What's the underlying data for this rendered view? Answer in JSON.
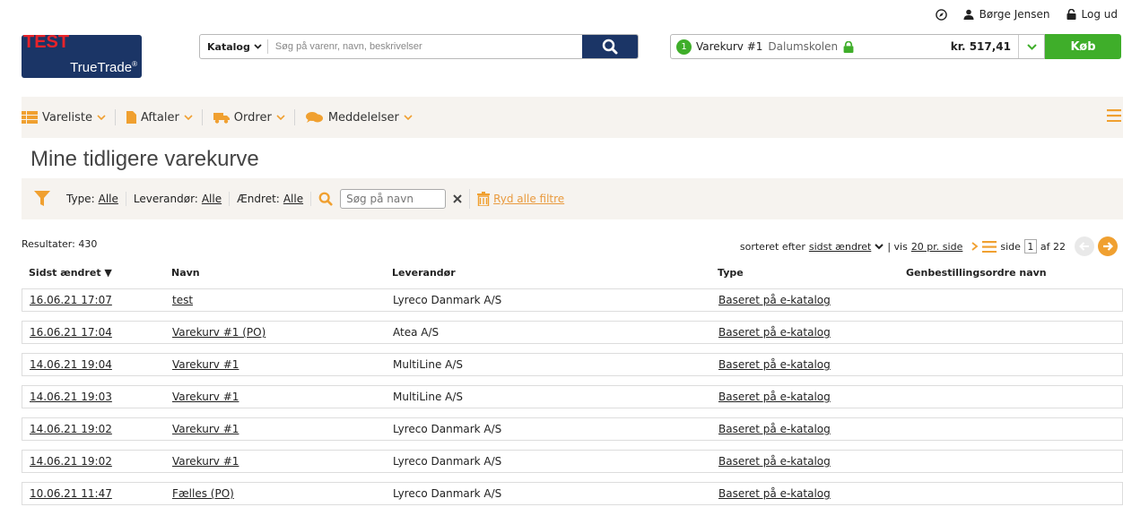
{
  "userbar": {
    "user_name": "Børge Jensen",
    "logout_label": "Log ud"
  },
  "logo": {
    "test_label": "TEST",
    "brand": "TrueTrade",
    "reg": "®"
  },
  "search": {
    "category_label": "Katalog",
    "placeholder": "Søg på varenr, navn, beskrivelser"
  },
  "cart": {
    "count": "1",
    "name": "Varekurv #1",
    "org": "Dalumskolen",
    "price": "kr. 517,41",
    "buy_label": "Køb"
  },
  "nav": {
    "items": [
      {
        "label": "Vareliste"
      },
      {
        "label": "Aftaler"
      },
      {
        "label": "Ordrer"
      },
      {
        "label": "Meddelelser"
      }
    ]
  },
  "page_title": "Mine tidligere varekurve",
  "filters": {
    "type_label": "Type:",
    "type_value": "Alle",
    "supplier_label": "Leverandør:",
    "supplier_value": "Alle",
    "changed_label": "Ændret:",
    "changed_value": "Alle",
    "search_placeholder": "Søg på navn",
    "clear_label": "Ryd alle filtre"
  },
  "results_label": "Resultater: 430",
  "pager": {
    "sort_prefix": "sorteret efter",
    "sort_value": "sidst ændret",
    "per_page_prefix": "| vis",
    "per_page_value": "20 pr. side",
    "side_label": "side",
    "page": "1",
    "of_label": "af 22"
  },
  "table": {
    "headers": {
      "changed": "Sidst ændret ▼",
      "name": "Navn",
      "supplier": "Leverandør",
      "type": "Type",
      "reorder": "Genbestillingsordre navn"
    },
    "rows": [
      {
        "changed": "16.06.21 17:07",
        "name": "test",
        "supplier": "Lyreco Danmark A/S",
        "type": "Baseret på e-katalog",
        "reorder": ""
      },
      {
        "changed": "16.06.21 17:04",
        "name": "Varekurv #1 (PO)",
        "supplier": "Atea A/S",
        "type": "Baseret på e-katalog",
        "reorder": ""
      },
      {
        "changed": "14.06.21 19:04",
        "name": "Varekurv #1",
        "supplier": "MultiLine A/S",
        "type": "Baseret på e-katalog",
        "reorder": ""
      },
      {
        "changed": "14.06.21 19:03",
        "name": "Varekurv #1",
        "supplier": "MultiLine A/S",
        "type": "Baseret på e-katalog",
        "reorder": ""
      },
      {
        "changed": "14.06.21 19:02",
        "name": "Varekurv #1",
        "supplier": "Lyreco Danmark A/S",
        "type": "Baseret på e-katalog",
        "reorder": ""
      },
      {
        "changed": "14.06.21 19:02",
        "name": "Varekurv #1",
        "supplier": "Lyreco Danmark A/S",
        "type": "Baseret på e-katalog",
        "reorder": ""
      },
      {
        "changed": "10.06.21 11:47",
        "name": "Fælles (PO)",
        "supplier": "Lyreco Danmark A/S",
        "type": "Baseret på e-katalog",
        "reorder": ""
      }
    ]
  },
  "colors": {
    "navy": "#1b3566",
    "green": "#3fae2a",
    "orange": "#f0a030",
    "red": "#e8232a",
    "bar_bg": "#f6f3ef"
  }
}
